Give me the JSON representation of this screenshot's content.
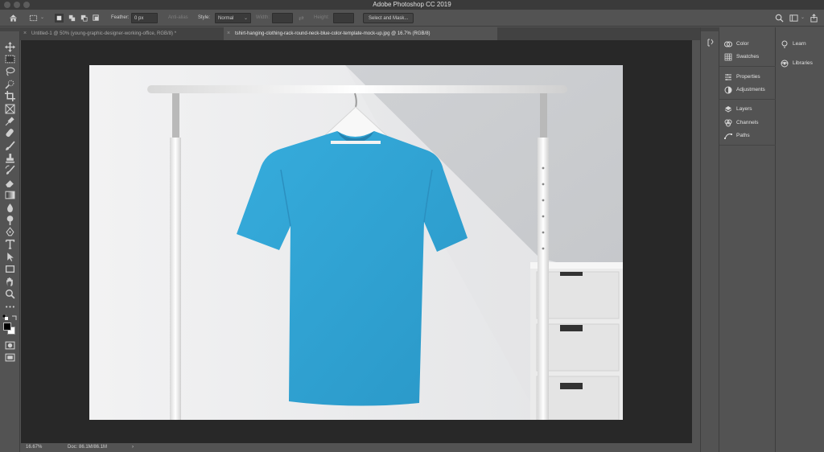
{
  "window": {
    "title": "Adobe Photoshop CC 2019"
  },
  "options_bar": {
    "feather_label": "Feather:",
    "feather_value": "0 px",
    "antialias_label": "Anti-alias",
    "style_label": "Style:",
    "style_value": "Normal",
    "width_label": "Width:",
    "height_label": "Height:",
    "select_mask_label": "Select and Mask..."
  },
  "tabs": [
    {
      "label": "Untitled-1 @ 50% (young-graphic-designer-working-office, RGB/8) *",
      "active": false
    },
    {
      "label": "tshirt-hanging-clothing-rack-round-neck-blue-color-template-mock-up.jpg @ 16.7% (RGB/8)",
      "active": true
    }
  ],
  "status": {
    "zoom": "16.67%",
    "doc": "Doc: 86.1M/86.1M",
    "arrow": "›"
  },
  "panels": {
    "group1": [
      "Color",
      "Swatches"
    ],
    "group2": [
      "Properties",
      "Adjustments"
    ],
    "group3": [
      "Layers",
      "Channels",
      "Paths"
    ],
    "group4": [
      "Learn",
      "Libraries"
    ]
  },
  "colors": {
    "shirt": "#2ea3d4",
    "ui_bg": "#535353",
    "canvas_bg": "#282828"
  }
}
